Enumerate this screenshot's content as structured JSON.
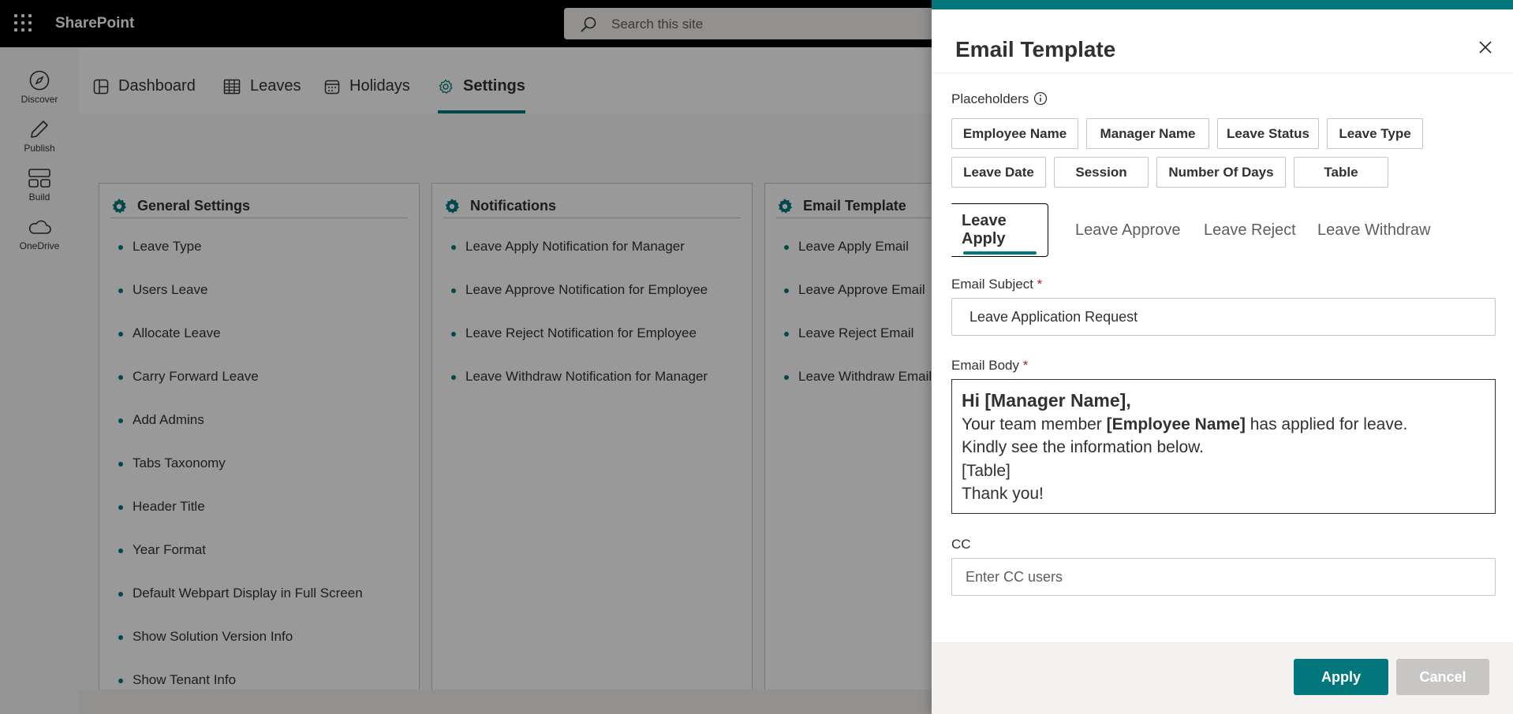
{
  "suitebar": {
    "brand": "SharePoint",
    "search_placeholder": "Search this site"
  },
  "apprail": {
    "items": [
      {
        "label": "Discover",
        "icon": "compass-icon"
      },
      {
        "label": "Publish",
        "icon": "pen-icon"
      },
      {
        "label": "Build",
        "icon": "grid-icon"
      },
      {
        "label": "OneDrive",
        "icon": "cloud-icon"
      }
    ]
  },
  "nav": {
    "tabs": [
      {
        "label": "Dashboard",
        "icon": "dashboard-icon"
      },
      {
        "label": "Leaves",
        "icon": "table-icon"
      },
      {
        "label": "Holidays",
        "icon": "calendar-icon"
      },
      {
        "label": "Settings",
        "icon": "gear-icon",
        "active": true
      }
    ]
  },
  "cards": [
    {
      "title": "General Settings",
      "items": [
        "Leave Type",
        "Users Leave",
        "Allocate Leave",
        "Carry Forward Leave",
        "Add Admins",
        "Tabs Taxonomy",
        "Header Title",
        "Year Format",
        "Default Webpart Display in Full Screen",
        "Show Solution Version Info",
        "Show Tenant Info"
      ]
    },
    {
      "title": "Notifications",
      "items": [
        "Leave Apply Notification for Manager",
        "Leave Approve Notification for Employee",
        "Leave Reject Notification for Employee",
        "Leave Withdraw Notification for Manager"
      ]
    },
    {
      "title": "Email Template",
      "items": [
        "Leave Apply Email",
        "Leave Approve Email",
        "Leave Reject Email",
        "Leave Withdraw Email"
      ]
    }
  ],
  "panel": {
    "title": "Email Template",
    "placeholders_label": "Placeholders",
    "placeholders": [
      "Employee Name",
      "Manager Name",
      "Leave Status",
      "Leave Type",
      "Leave Date",
      "Session",
      "Number Of Days",
      "Table"
    ],
    "tabs": [
      "Leave Apply",
      "Leave Approve",
      "Leave Reject",
      "Leave Withdraw"
    ],
    "active_tab": "Leave Apply",
    "subject_label": "Email Subject",
    "required_mark": "*",
    "subject_value": "Leave Application Request",
    "body_label": "Email Body",
    "body": {
      "greeting": "Hi [Manager Name],",
      "line2_prefix": "Your team member ",
      "line2_bold": "[Employee Name]",
      "line2_suffix": " has applied for leave.",
      "line3": "Kindly see the information below.",
      "line4": "[Table]",
      "line5": "Thank you!"
    },
    "cc_label": "CC",
    "cc_placeholder": "Enter CC users",
    "apply_label": "Apply",
    "cancel_label": "Cancel"
  },
  "colors": {
    "accent": "#03787c",
    "suitebar": "#000000",
    "required": "#a4262c"
  }
}
